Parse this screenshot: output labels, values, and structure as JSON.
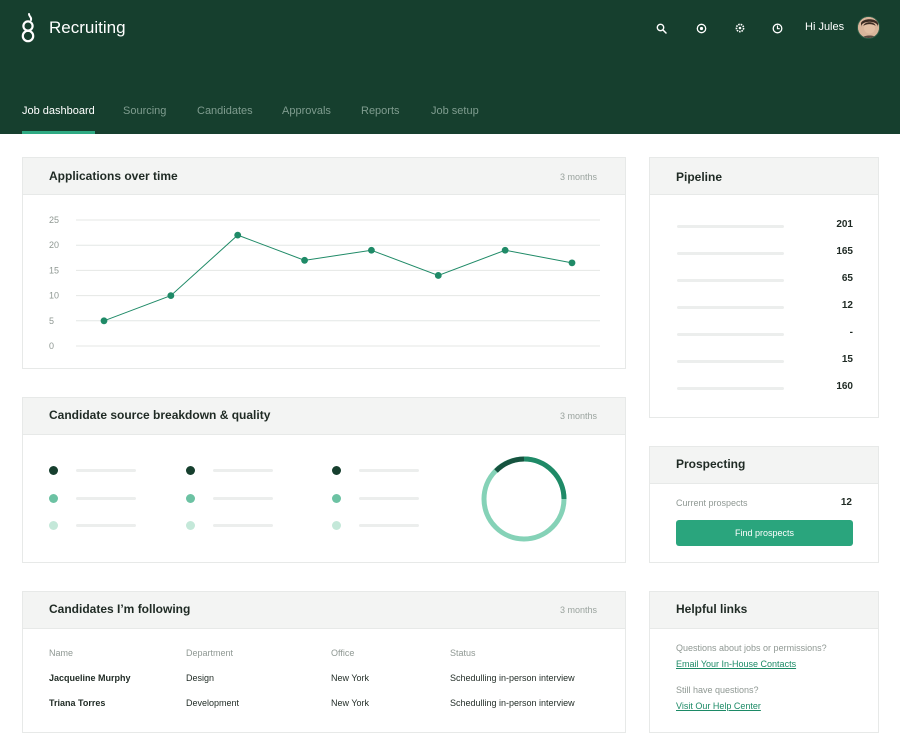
{
  "header": {
    "app_title": "Recruiting",
    "greeting": "Hi Jules",
    "icons": [
      "search-icon",
      "target-icon",
      "gear-icon",
      "clock-icon"
    ],
    "background": "#163f2e"
  },
  "tabs": [
    {
      "label": "Job dashboard",
      "active": true
    },
    {
      "label": "Sourcing"
    },
    {
      "label": "Candidates"
    },
    {
      "label": "Approvals"
    },
    {
      "label": "Reports"
    },
    {
      "label": "Job setup"
    }
  ],
  "applications": {
    "title": "Applications over time",
    "range": "3 months"
  },
  "chart_data": {
    "type": "line",
    "title": "Applications over time",
    "y_ticks": [
      0,
      5,
      10,
      15,
      20,
      25
    ],
    "ylim": [
      0,
      25
    ],
    "x": [
      1,
      2,
      3,
      4,
      5,
      6,
      7,
      8
    ],
    "values": [
      5,
      10,
      22,
      17,
      19,
      14,
      19,
      16.5
    ],
    "grid": true,
    "color": "#1f8a67"
  },
  "source": {
    "title": "Candidate source breakdown & quality",
    "range": "3 months",
    "shades": [
      "#163f2e",
      "#6cc2a3",
      "#c4e8d9"
    ],
    "donut_colors": [
      "#16533f",
      "#1f8a67",
      "#85d2b7"
    ]
  },
  "following": {
    "title": "Candidates I’m following",
    "range": "3 months",
    "columns": [
      "Name",
      "Department",
      "Office",
      "Status"
    ],
    "rows": [
      {
        "name": "Jacqueline Murphy",
        "department": "Design",
        "office": "New York",
        "status": "Schedulling in-person interview"
      },
      {
        "name": "Triana Torres",
        "department": "Development",
        "office": "New York",
        "status": "Schedulling in-person interview"
      }
    ]
  },
  "pipeline": {
    "title": "Pipeline",
    "values": [
      "201",
      "165",
      "65",
      "12",
      "-",
      "15",
      "160"
    ]
  },
  "prospecting": {
    "title": "Prospecting",
    "label": "Current prospects",
    "count": "12",
    "button": "Find prospects",
    "accent": "#2aa57d"
  },
  "help": {
    "title": "Helpful links",
    "q1": "Questions about jobs or permissions?",
    "link1": "Email Your In-House Contacts",
    "q2": "Still have questions?",
    "link2": "Visit Our Help Center"
  }
}
